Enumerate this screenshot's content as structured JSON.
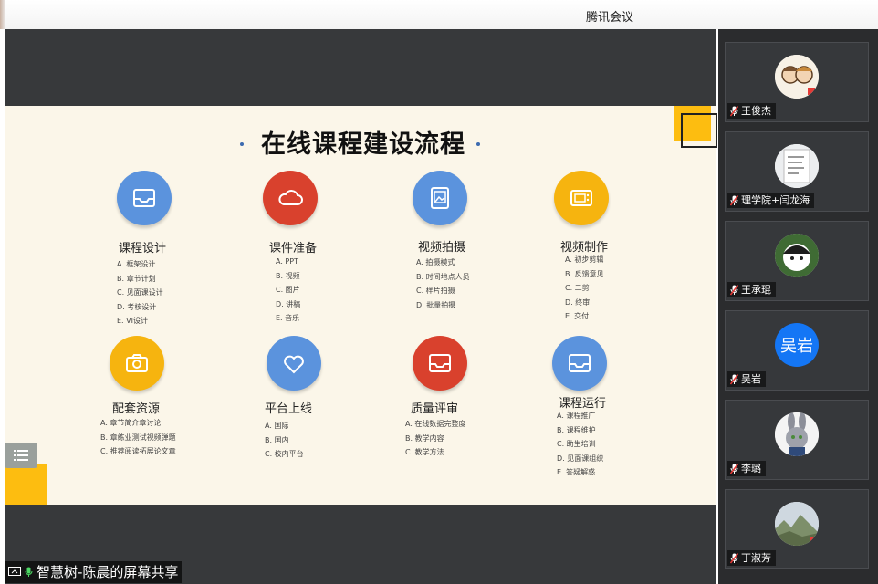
{
  "window": {
    "title": "腾讯会议"
  },
  "slide": {
    "title": "在线课程建设流程",
    "categories": [
      {
        "name": "课程设计",
        "items": [
          "A. 框架设计",
          "B. 章节计划",
          "C. 见面课设计",
          "D. 考核设计",
          "E. VI设计"
        ],
        "icon": "inbox-icon",
        "color": "#5b93dd"
      },
      {
        "name": "课件准备",
        "items": [
          "A. PPT",
          "B. 视频",
          "C. 图片",
          "D. 讲稿",
          "E. 音乐"
        ],
        "icon": "cloud-icon",
        "color": "#d9412d"
      },
      {
        "name": "视频拍摄",
        "items": [
          "A. 拍摄模式",
          "B. 时间地点人员",
          "C. 样片拍摄",
          "D. 批量拍摄"
        ],
        "icon": "image-icon",
        "color": "#5b93dd"
      },
      {
        "name": "视频制作",
        "items": [
          "A. 初步剪辑",
          "B. 反馈意见",
          "C. 二剪",
          "D. 终审",
          "E. 交付"
        ],
        "icon": "tv-icon",
        "color": "#f6b40f"
      },
      {
        "name": "配套资源",
        "items": [
          "A. 章节简介章讨论",
          "B. 章练业测试视频弹题",
          "C. 推荐阅读拓展论文章"
        ],
        "icon": "camera-icon",
        "color": "#f6b40f"
      },
      {
        "name": "平台上线",
        "items": [
          "A. 国际",
          "B. 国内",
          "C. 校内平台"
        ],
        "icon": "heart-icon",
        "color": "#5b93dd"
      },
      {
        "name": "质量评审",
        "items": [
          "A. 在线数据完整度",
          "B. 教学内容",
          "C. 教学方法"
        ],
        "icon": "inbox-icon",
        "color": "#d9412d"
      },
      {
        "name": "课程运行",
        "items": [
          "A. 课程推广",
          "B. 课程维护",
          "C. 助生培训",
          "D. 见面课组织",
          "E. 答疑解惑"
        ],
        "icon": "inbox-icon",
        "color": "#5b93dd"
      }
    ]
  },
  "participants": [
    {
      "name": "王俊杰",
      "avatar": "cartoon-couple"
    },
    {
      "name": "理学院+闫龙海",
      "avatar": "notebook-photo"
    },
    {
      "name": "王承琨",
      "avatar": "cartoon-boy"
    },
    {
      "name": "吴岩",
      "avatar_text": "吴岩",
      "avatar_color": "#1476f5"
    },
    {
      "name": "李璐",
      "avatar": "rabbit-cartoon"
    },
    {
      "name": "丁淑芳",
      "avatar": "landscape-photo"
    }
  ],
  "share_bar": {
    "label": "智慧树-陈晨的屏幕共享"
  }
}
